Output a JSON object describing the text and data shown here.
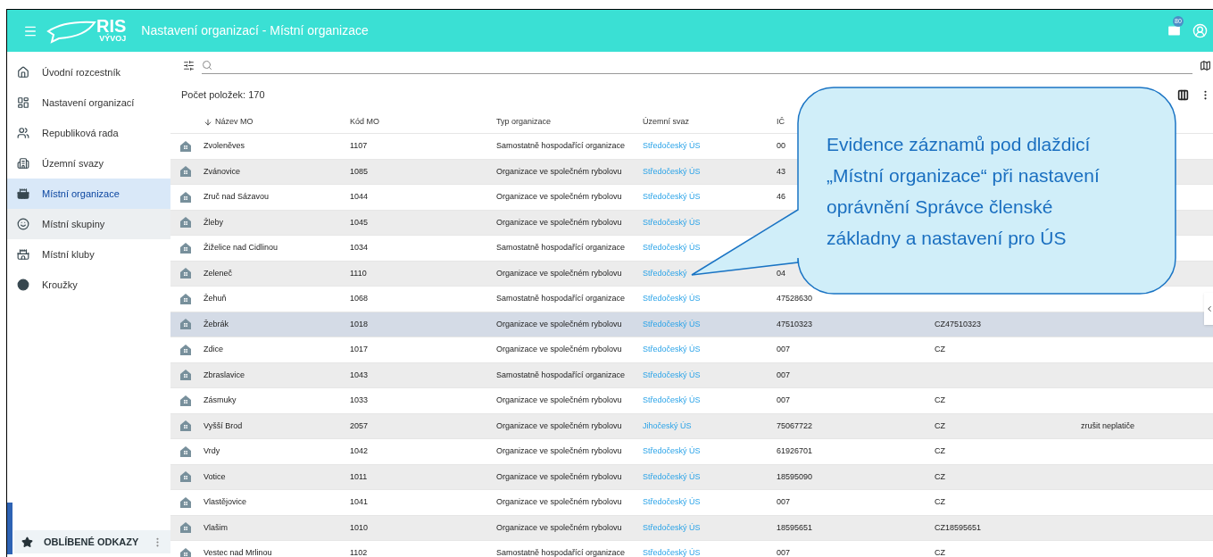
{
  "header": {
    "logo_text": "RIS",
    "logo_subtext": "VÝVOJ",
    "title": "Nastavení organizací - Místní organizace",
    "mail_badge": "80"
  },
  "sidebar": {
    "items": [
      {
        "label": "Úvodní rozcestník",
        "selected": false,
        "hovered": false
      },
      {
        "label": "Nastavení organizací",
        "selected": false,
        "hovered": false
      },
      {
        "label": "Republiková rada",
        "selected": false,
        "hovered": false
      },
      {
        "label": "Územní svazy",
        "selected": false,
        "hovered": false
      },
      {
        "label": "Místní organizace",
        "selected": true,
        "hovered": false
      },
      {
        "label": "Místní skupiny",
        "selected": false,
        "hovered": true
      },
      {
        "label": "Místní kluby",
        "selected": false,
        "hovered": false
      },
      {
        "label": "Kroužky",
        "selected": false,
        "hovered": false
      }
    ],
    "favorites": "OBLÍBENÉ ODKAZY"
  },
  "count": "Počet položek: 170",
  "table": {
    "columns": [
      "Název MO",
      "Kód MO",
      "Typ organizace",
      "Územní svaz",
      "IČ",
      "",
      ""
    ],
    "rows": [
      {
        "cells": [
          "Zvoleněves",
          "1107",
          "Samostatně hospodařící organizace",
          "Středočeský ÚS",
          "00",
          "",
          ""
        ],
        "selected": false
      },
      {
        "cells": [
          "Zvánovice",
          "1085",
          "Organizace ve společném rybolovu",
          "Středočeský ÚS",
          "43",
          "",
          ""
        ],
        "selected": false
      },
      {
        "cells": [
          "Zruč nad Sázavou",
          "1044",
          "Organizace ve společném rybolovu",
          "Středočeský ÚS",
          "46",
          "",
          ""
        ],
        "selected": false
      },
      {
        "cells": [
          "Žleby",
          "1045",
          "Organizace ve společném rybolovu",
          "Středočeský ÚS",
          "",
          "",
          ""
        ],
        "selected": false
      },
      {
        "cells": [
          "Žiželice nad Cidlinou",
          "1034",
          "Samostatně hospodařící organizace",
          "Středočeský ÚS",
          "",
          "",
          ""
        ],
        "selected": false
      },
      {
        "cells": [
          "Zeleneč",
          "1110",
          "Organizace ve společném rybolovu",
          "Středočeský",
          "04",
          "",
          ""
        ],
        "selected": false
      },
      {
        "cells": [
          "Žehuň",
          "1068",
          "Samostatně hospodařící organizace",
          "Středočeský ÚS",
          "47528630",
          "",
          ""
        ],
        "selected": false
      },
      {
        "cells": [
          "Žebrák",
          "1018",
          "Organizace ve společném rybolovu",
          "Středočeský ÚS",
          "47510323",
          "CZ47510323",
          ""
        ],
        "selected": true
      },
      {
        "cells": [
          "Zdice",
          "1017",
          "Organizace ve společném rybolovu",
          "Středočeský ÚS",
          "007",
          "CZ",
          ""
        ],
        "selected": false
      },
      {
        "cells": [
          "Zbraslavice",
          "1043",
          "Samostatně hospodařící organizace",
          "Středočeský ÚS",
          "007",
          "",
          ""
        ],
        "selected": false
      },
      {
        "cells": [
          "Zásmuky",
          "1033",
          "Organizace ve společném rybolovu",
          "Středočeský ÚS",
          "007",
          "CZ",
          ""
        ],
        "selected": false
      },
      {
        "cells": [
          "Vyšší Brod",
          "2057",
          "Organizace ve společném rybolovu",
          "Jihočeský ÚS",
          "75067722",
          "CZ",
          "zrušit neplatiče"
        ],
        "selected": false
      },
      {
        "cells": [
          "Vrdy",
          "1042",
          "Organizace ve společném rybolovu",
          "Středočeský ÚS",
          "61926701",
          "CZ",
          ""
        ],
        "selected": false
      },
      {
        "cells": [
          "Votice",
          "1011",
          "Organizace ve společném rybolovu",
          "Středočeský ÚS",
          "18595090",
          "CZ",
          ""
        ],
        "selected": false
      },
      {
        "cells": [
          "Vlastějovice",
          "1041",
          "Organizace ve společném rybolovu",
          "Středočeský ÚS",
          "007",
          "CZ",
          ""
        ],
        "selected": false
      },
      {
        "cells": [
          "Vlašim",
          "1010",
          "Organizace ve společném rybolovu",
          "Středočeský ÚS",
          "18595651",
          "CZ18595651",
          ""
        ],
        "selected": false
      },
      {
        "cells": [
          "Vestec nad Mrlinou",
          "1102",
          "Samostatně hospodařící organizace",
          "Středočeský ÚS",
          "007",
          "CZ",
          ""
        ],
        "selected": false
      }
    ]
  },
  "callout": {
    "text": "Evidence záznamů pod dlaždicí „Místní organizace“ při nastavení oprávnění Správce členské základny a nastavení pro ÚS"
  }
}
